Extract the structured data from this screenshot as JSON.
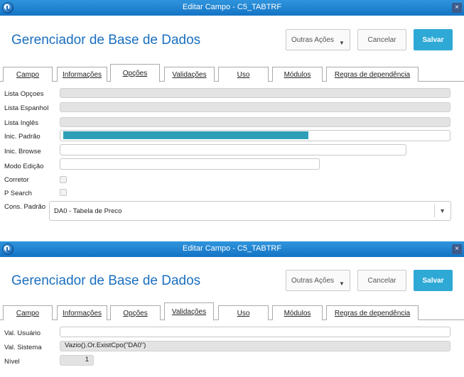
{
  "window1": {
    "title": "Editar Campo - C5_TABTRF",
    "header_title": "Gerenciador de Base de Dados",
    "buttons": {
      "other": "Outras Ações",
      "cancel": "Cancelar",
      "save": "Salvar"
    },
    "tabs": [
      "Campo",
      "Informações",
      "Opções",
      "Validações",
      "Uso",
      "Módulos",
      "Regras de dependência"
    ],
    "active_tab": "Opções",
    "fields": {
      "lista_opcoes": {
        "label": "Lista Opçoes",
        "value": ""
      },
      "lista_espanhol": {
        "label": "Lista Espanhol",
        "value": ""
      },
      "lista_ingles": {
        "label": "Lista Inglês",
        "value": ""
      },
      "inic_padrao": {
        "label": "Inic. Padrão",
        "value": ""
      },
      "inic_browse": {
        "label": "Inic. Browse",
        "value": ""
      },
      "modo_edicao": {
        "label": "Modo Edição",
        "value": ""
      },
      "corretor": {
        "label": "Corretor",
        "checked": false
      },
      "p_search": {
        "label": "P Search",
        "checked": false
      },
      "cons_padrao": {
        "label": "Cons. Padrão",
        "value": "DA0 - Tabela de Preco"
      }
    }
  },
  "window2": {
    "title": "Editar Campo - C5_TABTRF",
    "header_title": "Gerenciador de Base de Dados",
    "buttons": {
      "other": "Outras Ações",
      "cancel": "Cancelar",
      "save": "Salvar"
    },
    "tabs": [
      "Campo",
      "Informações",
      "Opções",
      "Validações",
      "Uso",
      "Módulos",
      "Regras de dependência"
    ],
    "active_tab": "Validações",
    "fields": {
      "val_usuario": {
        "label": "Val. Usuário",
        "value": ""
      },
      "val_sistema": {
        "label": "Val. Sistema",
        "value": "Vazio().Or.ExistCpo(\"DA0\")"
      },
      "nivel": {
        "label": "Nível",
        "value": "1"
      }
    }
  },
  "colors": {
    "titlebar": "#1a7fd0",
    "brand": "#1a6fc0",
    "save": "#2ea9d6",
    "selection": "#2f9fb7"
  }
}
